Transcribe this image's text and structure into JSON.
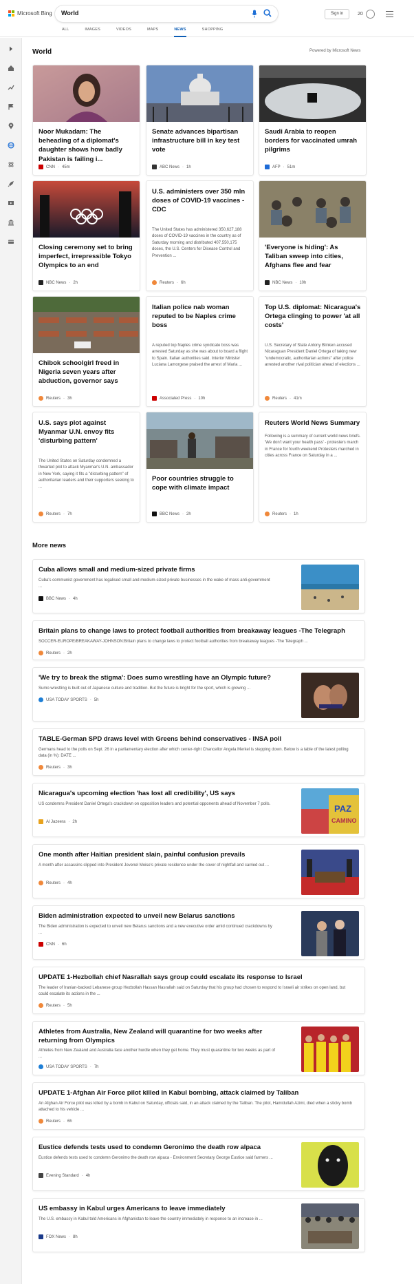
{
  "header": {
    "brand": "Microsoft Bing",
    "search_value": "World",
    "signin_label": "Sign in",
    "rewards_count": "20",
    "tabs": [
      {
        "label": "ALL"
      },
      {
        "label": "IMAGES"
      },
      {
        "label": "VIDEOS"
      },
      {
        "label": "MAPS"
      },
      {
        "label": "NEWS"
      },
      {
        "label": "SHOPPING"
      }
    ],
    "active_tab": "NEWS"
  },
  "sidebar": {
    "icons": [
      "expand-icon",
      "home-icon",
      "trending-icon",
      "flag-icon",
      "location-icon",
      "globe-icon",
      "science-icon",
      "rocket-icon",
      "video-icon",
      "bank-icon",
      "card-icon"
    ]
  },
  "section": {
    "title": "World",
    "powered_by": "Powered by Microsoft News"
  },
  "cards": [
    {
      "title": "Noor Mukadam: The beheading of a diplomat's daughter shows how badly Pakistan is failing i...",
      "snippet": "",
      "source": "CNN",
      "time": "45m",
      "has_image": true,
      "logo_color": "#cc0000"
    },
    {
      "title": "Senate advances bipartisan infrastructure bill in key test vote",
      "snippet": "",
      "source": "ABC News",
      "time": "1h",
      "has_image": true,
      "logo_color": "#333333"
    },
    {
      "title": "Saudi Arabia to reopen borders for vaccinated umrah pilgrims",
      "snippet": "",
      "source": "AFP",
      "time": "51m",
      "has_image": true,
      "logo_color": "#1e6bd6"
    },
    {
      "title": "Closing ceremony set to bring imperfect, irrepressible Tokyo Olympics to an end",
      "snippet": "",
      "source": "NBC News",
      "time": "2h",
      "has_image": true,
      "logo_color": "#222222"
    },
    {
      "title": "U.S. administers over 350 mln doses of COVID-19 vaccines - CDC",
      "snippet": "The United States has administered 350,627,188 doses of COVID-19 vaccines in the country as of Saturday morning and distributed 407,550,175 doses, the U.S. Centers for Disease Control and Prevention ...",
      "source": "Reuters",
      "time": "6h",
      "has_image": false,
      "logo_color": "#f0883a"
    },
    {
      "title": "'Everyone is hiding': As Taliban sweep into cities, Afghans flee and fear",
      "snippet": "",
      "source": "NBC News",
      "time": "10h",
      "has_image": true,
      "logo_color": "#222222"
    },
    {
      "title": "Chibok schoolgirl freed in Nigeria seven years after abduction, governor says",
      "snippet": "",
      "source": "Reuters",
      "time": "3h",
      "has_image": true,
      "logo_color": "#f0883a"
    },
    {
      "title": "Italian police nab woman reputed to be Naples crime boss",
      "snippet": "A reputed top Naples crime syndicate boss was arrested Saturday as she was about to board a flight to Spain. Italian authorities said. Interior Minister Luciana Lamorgese praised the arrest of Maria ...",
      "source": "Associated Press",
      "time": "10h",
      "has_image": false,
      "logo_color": "#cc0000"
    },
    {
      "title": "Top U.S. diplomat: Nicaragua's Ortega clinging to power 'at all costs'",
      "snippet": "U.S. Secretary of State Antony Blinken accused Nicaraguan President Daniel Ortega of taking new \"undemocratic, authoritarian actions\" after police arrested another rival politician ahead of elections ...",
      "source": "Reuters",
      "time": "41m",
      "has_image": false,
      "logo_color": "#f0883a"
    },
    {
      "title": "U.S. says plot against Myanmar U.N. envoy fits 'disturbing pattern'",
      "snippet": "The United States on Saturday condemned a thwarted plot to attack Myanmar's U.N. ambassador in New York, saying it fits a \"disturbing pattern\" of authoritarian leaders and their supporters seeking to ...",
      "source": "Reuters",
      "time": "7h",
      "has_image": false,
      "logo_color": "#f0883a"
    },
    {
      "title": "Poor countries struggle to cope with climate impact",
      "snippet": "",
      "source": "BBC News",
      "time": "2h",
      "has_image": true,
      "logo_color": "#111111"
    },
    {
      "title": "Reuters World News Summary",
      "snippet": "Following is a summary of current world news briefs. 'We don't want your health pass' - protesters march in France for fourth weekend Protesters marched in cities across France on Saturday in a ...",
      "source": "Reuters",
      "time": "1h",
      "has_image": false,
      "logo_color": "#f0883a"
    }
  ],
  "more_news": {
    "title": "More news",
    "items": [
      {
        "title": "Cuba allows small and medium-sized private firms",
        "snippet": "Cuba's communist government has legalised small and medium-sized private businesses in the wake of mass anti-government ...",
        "source": "BBC News",
        "time": "4h",
        "has_image": true,
        "logo_color": "#111111"
      },
      {
        "title": "Britain plans to change laws to protect football authorities from breakaway leagues -The Telegraph",
        "snippet": "SOCCER-EUROPE/BREAKAWAY-JOHNSON:Britain plans to change laws to protect football authorities from breakaway leagues -The Telegraph ...",
        "source": "Reuters",
        "time": "2h",
        "has_image": false,
        "logo_color": "#f0883a"
      },
      {
        "title": "'We try to break the stigma': Does sumo wrestling have an Olympic future?",
        "snippet": "Sumo wrestling is built out of Japanese culture and tradition. But the future is bright for the sport, which is growing ...",
        "source": "USA TODAY SPORTS",
        "time": "5h",
        "has_image": true,
        "logo_color": "#1e7fd6"
      },
      {
        "title": "TABLE-German SPD draws level with Greens behind conservatives - INSA poll",
        "snippet": "Germans head to the polls on Sept. 26 in a parliamentary election after which center-right Chancellor Angela Merkel is stepping down. Below is a table of the latest polling data (in %): DATE ...",
        "source": "Reuters",
        "time": "3h",
        "has_image": false,
        "logo_color": "#f0883a"
      },
      {
        "title": "Nicaragua's upcoming election 'has lost all credibility', US says",
        "snippet": "US condemns President Daniel Ortega's crackdown on opposition leaders and potential opponents ahead of November 7 polls.",
        "source": "Al Jazeera",
        "time": "2h",
        "has_image": true,
        "logo_color": "#e8a21c"
      },
      {
        "title": "One month after Haitian president slain, painful confusion prevails",
        "snippet": "A month after assassins slipped into President Jovenel Moise's private residence under the cover of nightfall and carried out ...",
        "source": "Reuters",
        "time": "4h",
        "has_image": true,
        "logo_color": "#f0883a"
      },
      {
        "title": "Biden administration expected to unveil new Belarus sanctions",
        "snippet": "The Biden administration is expected to unveil new Belarus sanctions and a new executive order amid continued crackdowns by ...",
        "source": "CNN",
        "time": "6h",
        "has_image": true,
        "logo_color": "#cc0000"
      },
      {
        "title": "UPDATE 1-Hezbollah chief Nasrallah says group could escalate its response to Israel",
        "snippet": "The leader of Iranian-backed Lebanese group Hezbollah Hassan Nasrallah said on Saturday that his group had chosen to respond to Israeli air strikes on open land, but could escalate its actions in the ...",
        "source": "Reuters",
        "time": "5h",
        "has_image": false,
        "logo_color": "#f0883a"
      },
      {
        "title": "Athletes from Australia, New Zealand will quarantine for two weeks after returning from Olympics",
        "snippet": "Athletes from New Zealand and Australia face another hurdle when they get home. They must quarantine for two weeks as part of ...",
        "source": "USA TODAY SPORTS",
        "time": "7h",
        "has_image": true,
        "logo_color": "#1e7fd6"
      },
      {
        "title": "UPDATE 1-Afghan Air Force pilot killed in Kabul bombing, attack claimed by Taliban",
        "snippet": "An Afghan Air Force pilot was killed by a bomb in Kabul on Saturday, officials said, in an attack claimed by the Taliban. The pilot, Hamidullah Azimi, died when a sticky bomb attached to his vehicle ...",
        "source": "Reuters",
        "time": "6h",
        "has_image": false,
        "logo_color": "#f0883a"
      },
      {
        "title": "Eustice defends tests used to condemn Geronimo the death row alpaca",
        "snippet": "Eustice defends tests used to condemn Geronimo the death row alpaca - Environment Secretary George Eustice said farmers ...",
        "source": "Evening Standard",
        "time": "4h",
        "has_image": true,
        "logo_color": "#444444"
      },
      {
        "title": "US embassy in Kabul urges Americans to leave immediately",
        "snippet": "The U.S. embassy in Kabul told Americans in Afghanistan to leave the country immediately in response to an increase in ...",
        "source": "FOX News",
        "time": "8h",
        "has_image": true,
        "logo_color": "#1a3a8a"
      }
    ]
  }
}
